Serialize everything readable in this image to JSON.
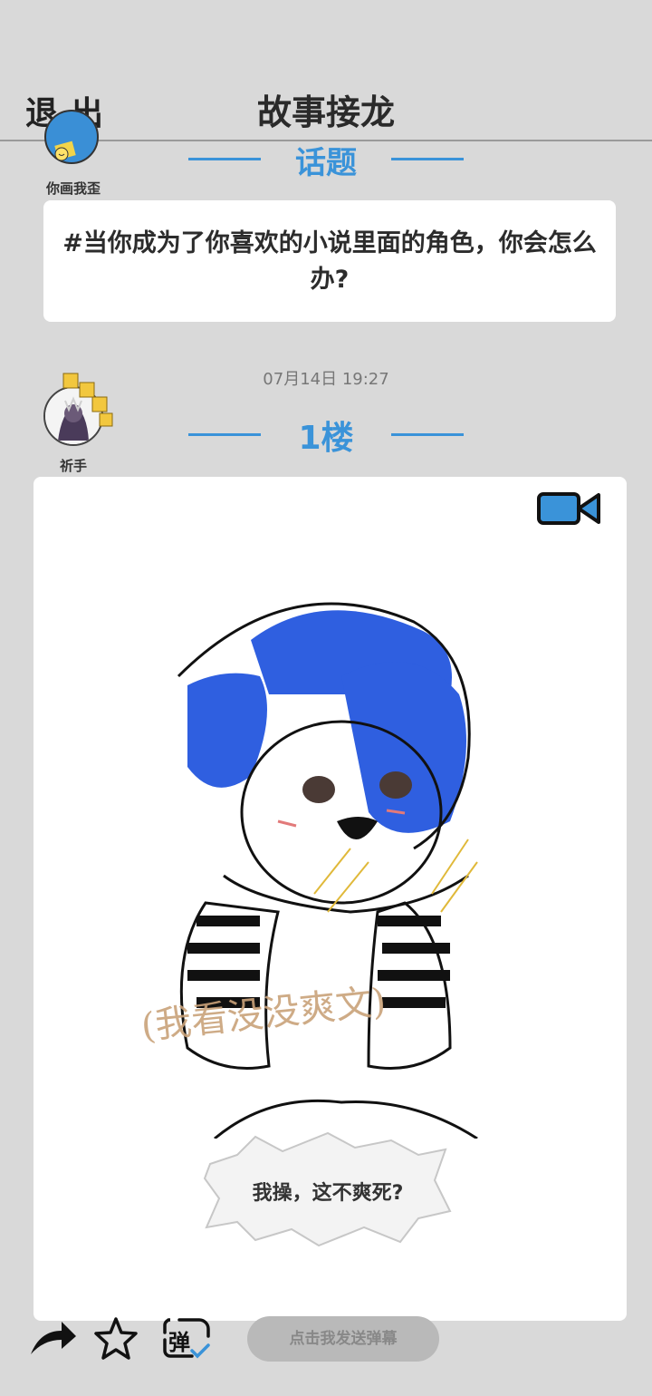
{
  "header": {
    "exit_label": "退出",
    "title": "故事接龙"
  },
  "topic": {
    "author_name": "你画我歪",
    "section_title": "话题",
    "text": "#当你成为了你喜欢的小说里面的角色，你会怎么办?"
  },
  "post": {
    "timestamp": "07月14日  19:27",
    "floor_label": "1楼",
    "author_name": "祈手",
    "speech_bubble": "我操，这不爽死?",
    "handwritten_note": "(我看没没爽文)"
  },
  "bottom_bar": {
    "danmaku_placeholder": "点击我发送弹幕",
    "danmaku_icon_char": "弹"
  },
  "colors": {
    "accent": "#3a93d9",
    "background": "#d9d9d9",
    "card": "#ffffff"
  },
  "icons": [
    "share-icon",
    "star-icon",
    "danmaku-toggle-icon",
    "video-icon"
  ]
}
